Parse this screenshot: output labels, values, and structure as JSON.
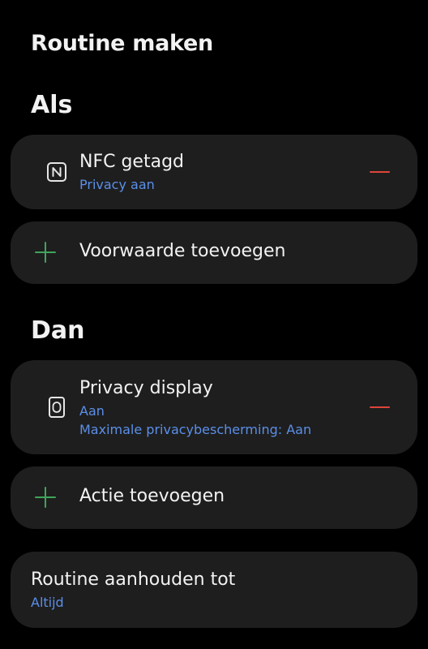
{
  "page_title": "Routine maken",
  "if_section": {
    "heading": "Als",
    "condition": {
      "icon": "nfc-icon",
      "title": "NFC getagd",
      "subtitle": "Privacy aan"
    },
    "add_label": "Voorwaarde toevoegen"
  },
  "then_section": {
    "heading": "Dan",
    "action": {
      "icon": "privacy-display-icon",
      "title": "Privacy display",
      "subtitle_1": "Aan",
      "subtitle_2": "Maximale privacybescherming: Aan"
    },
    "add_label": "Actie toevoegen"
  },
  "keep_until": {
    "title": "Routine aanhouden tot",
    "value": "Altijd"
  },
  "colors": {
    "background": "#000000",
    "card": "#1e1e1e",
    "accent_blue": "#5b8fe8",
    "remove_red": "#e0453a",
    "add_green": "#3fa55b"
  }
}
